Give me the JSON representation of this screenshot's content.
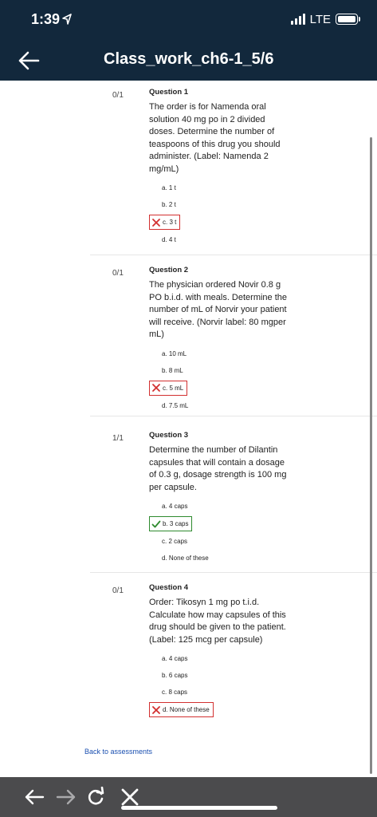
{
  "status_bar": {
    "time": "1:39",
    "network": "LTE"
  },
  "header": {
    "title": "Class_work_ch6-1_5/6"
  },
  "questions": [
    {
      "score": "0/1",
      "title": "Question 1",
      "text": "The order is for Namenda oral solution 40 mg po in 2 divided doses. Determine the number of teaspoons of this drug you should administer. (Label: Namenda 2 mg/mL)",
      "options": [
        {
          "label": "a. 1 t",
          "state": "none"
        },
        {
          "label": "b. 2 t",
          "state": "none"
        },
        {
          "label": "c. 3 t",
          "state": "wrong"
        },
        {
          "label": "d. 4 t",
          "state": "none"
        }
      ]
    },
    {
      "score": "0/1",
      "title": "Question 2",
      "text": "The physician ordered Novir 0.8 g PO b.i.d. with meals. Determine the number of mL of Norvir your patient will receive. (Norvir label: 80 mgper mL)",
      "options": [
        {
          "label": "a. 10 mL",
          "state": "none"
        },
        {
          "label": "b. 8 mL",
          "state": "none"
        },
        {
          "label": "c. 5 mL",
          "state": "wrong"
        },
        {
          "label": "d. 7.5 mL",
          "state": "none"
        }
      ]
    },
    {
      "score": "1/1",
      "title": "Question 3",
      "text": "Determine the number of Dilantin capsules that will contain a dosage of 0.3 g, dosage strength is 100 mg per capsule.",
      "options": [
        {
          "label": "a. 4 caps",
          "state": "none"
        },
        {
          "label": "b. 3 caps",
          "state": "correct"
        },
        {
          "label": "c. 2 caps",
          "state": "none"
        },
        {
          "label": "d. None of these",
          "state": "none"
        }
      ]
    },
    {
      "score": "0/1",
      "title": "Question 4",
      "text": "Order: Tikosyn 1 mg po t.i.d. Calculate how may capsules of this drug should be given to the patient. (Label: 125 mcg per capsule)",
      "options": [
        {
          "label": "a. 4 caps",
          "state": "none"
        },
        {
          "label": "b. 6 caps",
          "state": "none"
        },
        {
          "label": "c. 8 caps",
          "state": "none"
        },
        {
          "label": "d. None of these",
          "state": "wrong"
        }
      ]
    }
  ],
  "footer": {
    "back_link": "Back to assessments"
  },
  "colors": {
    "header_bg": "#12283c",
    "wrong": "#d23030",
    "correct": "#2e8a2e",
    "link": "#1a4fb0",
    "browser_bar": "#4b4b4d"
  },
  "icons": {
    "header": [
      "location-arrow-icon",
      "signal-icon",
      "battery-icon",
      "back-arrow-icon"
    ],
    "browser": [
      "browser-back-icon",
      "browser-forward-icon",
      "reload-icon",
      "close-icon"
    ]
  }
}
